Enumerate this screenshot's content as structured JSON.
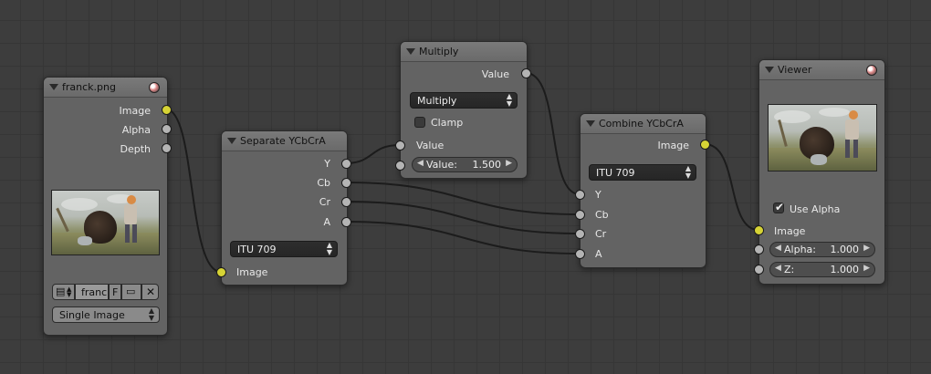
{
  "nodes": {
    "image": {
      "title": "franck.png",
      "outputs": [
        "Image",
        "Alpha",
        "Depth"
      ],
      "file_name": "franc",
      "fake_user": "F",
      "source_options_selected": "Single Image"
    },
    "separate": {
      "title": "Separate YCbCrA",
      "outputs": [
        "Y",
        "Cb",
        "Cr",
        "A"
      ],
      "mode": "ITU 709",
      "input": "Image"
    },
    "multiply": {
      "title": "Multiply",
      "output": "Value",
      "operation": "Multiply",
      "clamp_label": "Clamp",
      "input_value_label": "Value",
      "value_field_label": "Value:",
      "value_field_value": "1.500"
    },
    "combine": {
      "title": "Combine YCbCrA",
      "output": "Image",
      "mode": "ITU 709",
      "inputs": [
        "Y",
        "Cb",
        "Cr",
        "A"
      ]
    },
    "viewer": {
      "title": "Viewer",
      "use_alpha_label": "Use Alpha",
      "input_image": "Image",
      "alpha_label": "Alpha:",
      "alpha_value": "1.000",
      "z_label": "Z:",
      "z_value": "1.000"
    }
  },
  "colors": {
    "image_socket": "#d6d335",
    "value_socket": "#b4b4b4",
    "wire": "#1a1a1a",
    "node_body": "#636363",
    "background": "#3d3d3d"
  },
  "icons": [
    "collapse-arrow-icon",
    "sphere-preview-icon",
    "image-browse-icon",
    "folder-icon",
    "close-icon",
    "check-icon"
  ]
}
